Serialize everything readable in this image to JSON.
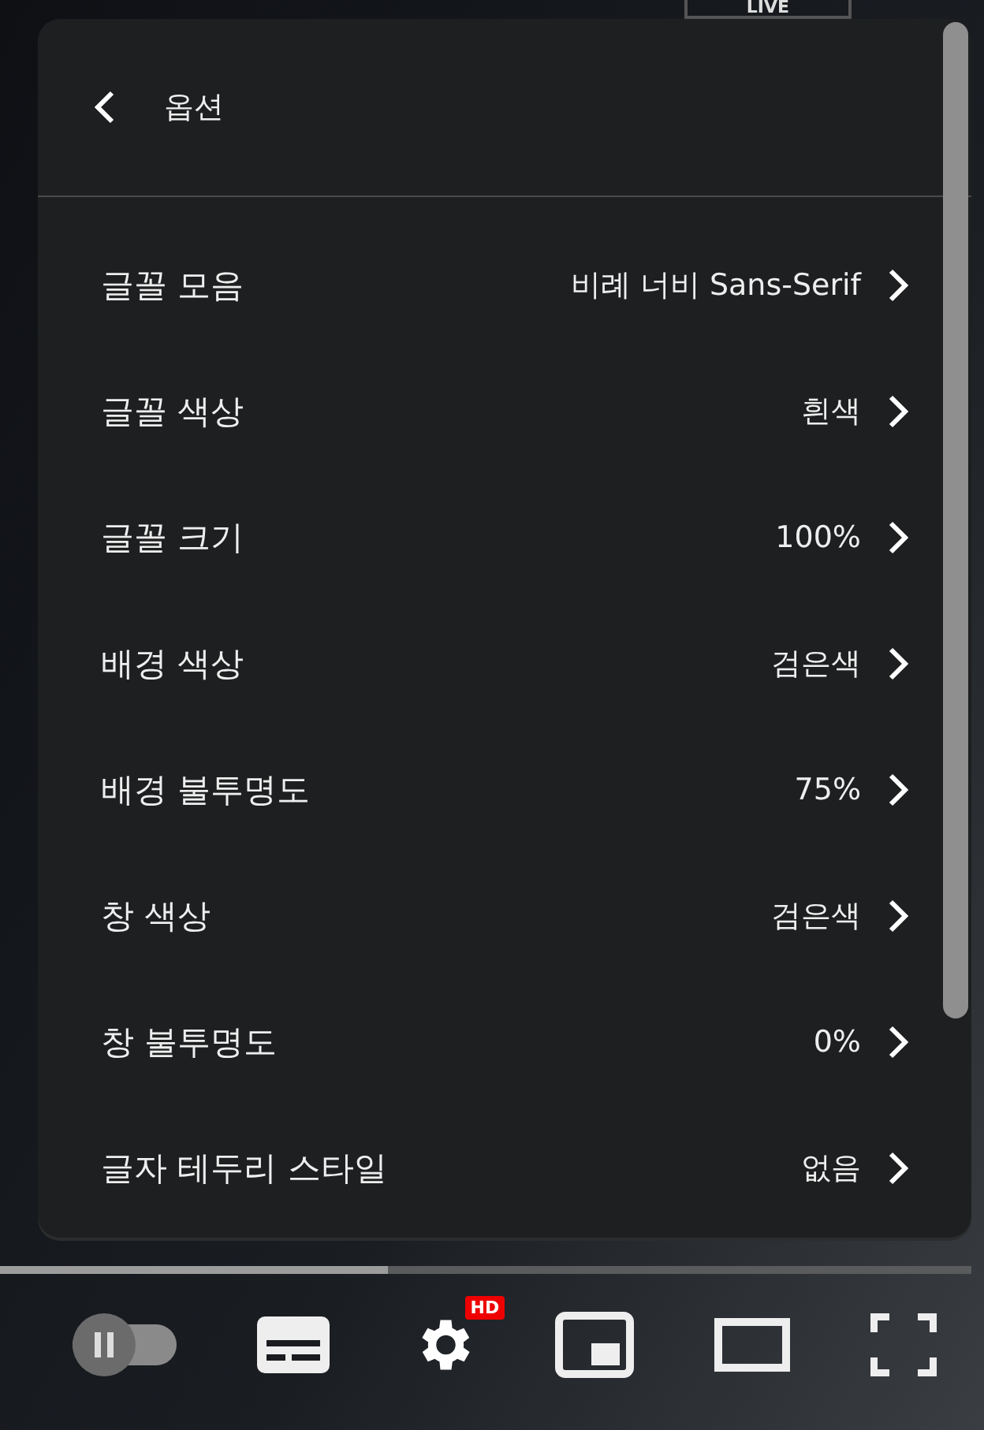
{
  "live_badge": "LIVE",
  "menu": {
    "title": "옵션",
    "items": [
      {
        "label": "글꼴 모음",
        "value": "비례 너비 Sans-Serif"
      },
      {
        "label": "글꼴 색상",
        "value": "흰색"
      },
      {
        "label": "글꼴 크기",
        "value": "100%"
      },
      {
        "label": "배경 색상",
        "value": "검은색"
      },
      {
        "label": "배경 불투명도",
        "value": "75%"
      },
      {
        "label": "창 색상",
        "value": "검은색"
      },
      {
        "label": "창 불투명도",
        "value": "0%"
      },
      {
        "label": "글자 테두리 스타일",
        "value": "없음"
      }
    ]
  },
  "progress": {
    "level": 0.4
  },
  "autoplay": {
    "on": false
  },
  "quality_badge": "HD"
}
